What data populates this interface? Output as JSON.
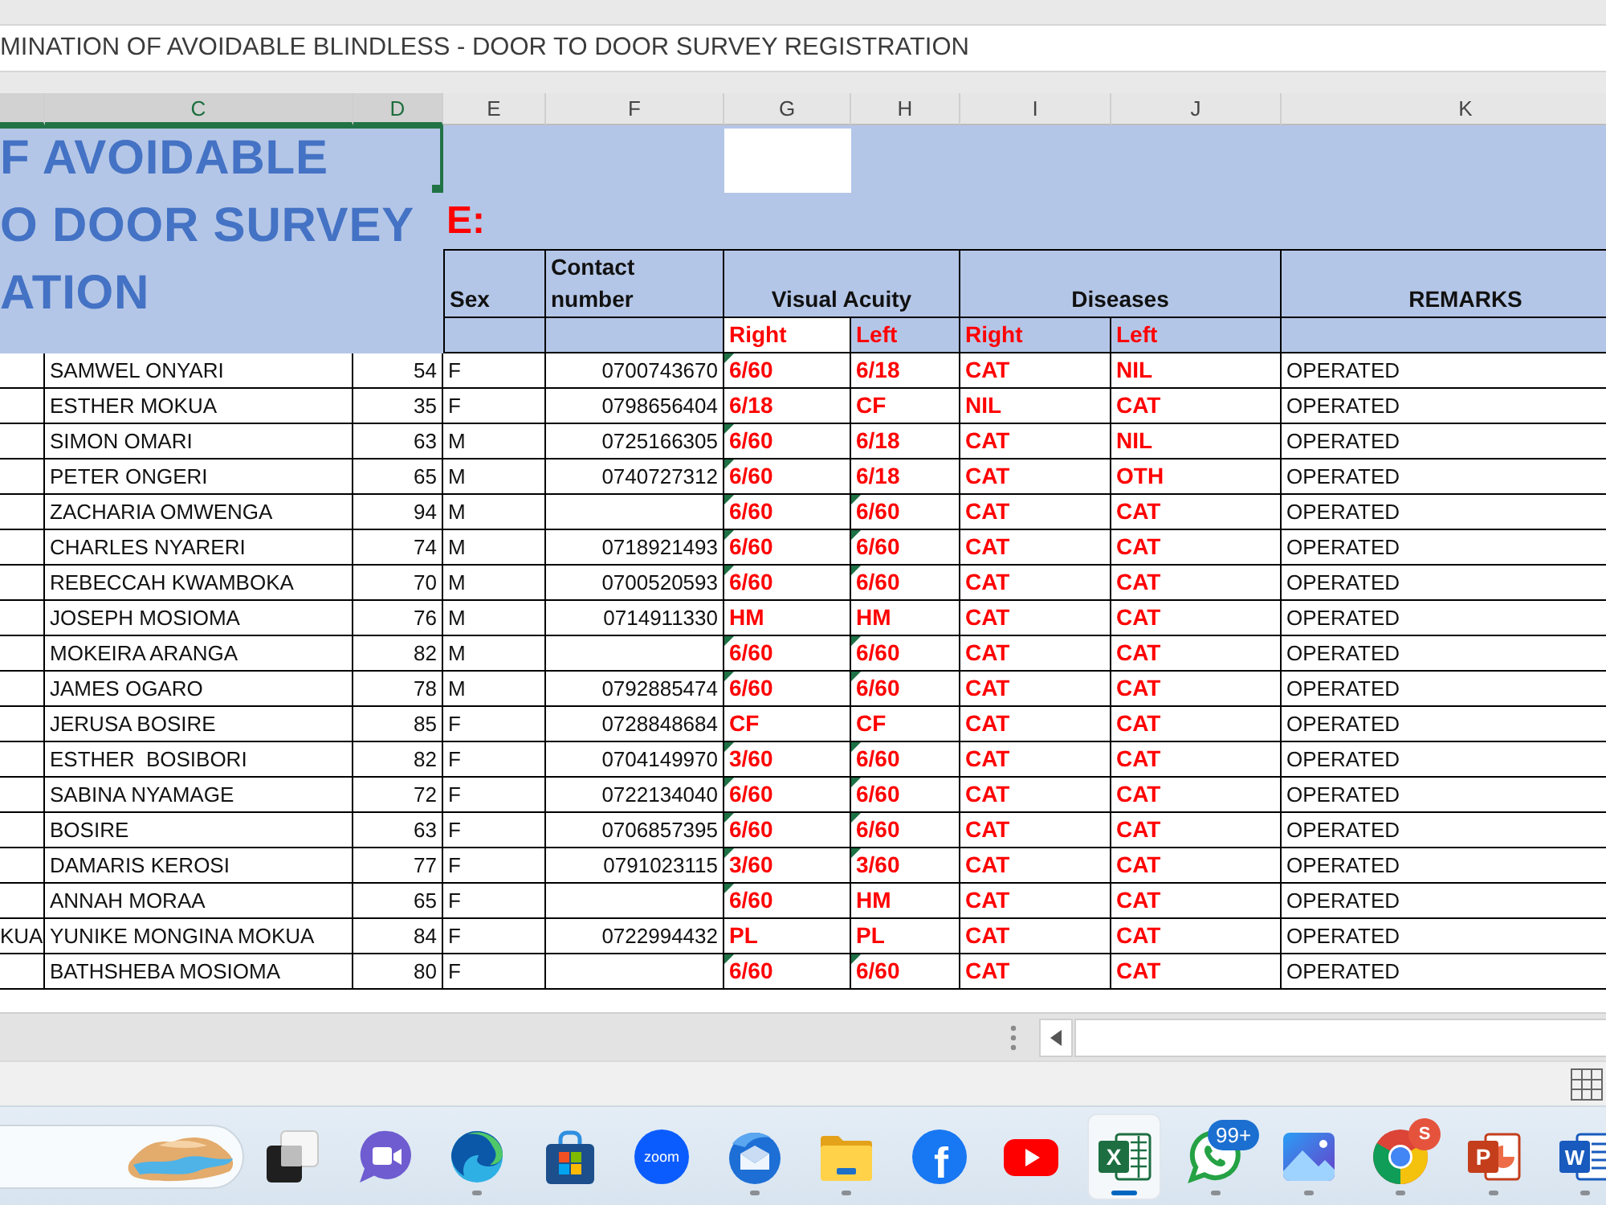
{
  "formula_bar": {
    "value": "MINATION OF AVOIDABLE BLINDLESS - DOOR TO DOOR SURVEY REGISTRATION"
  },
  "column_headers": [
    {
      "selected": true
    },
    {
      "label": "C",
      "selected": true
    },
    {
      "label": "D",
      "selected": true
    },
    {
      "label": "E",
      "selected": false
    },
    {
      "label": "F",
      "selected": false
    },
    {
      "label": "G",
      "selected": false
    },
    {
      "label": "H",
      "selected": false
    },
    {
      "label": "I",
      "selected": false
    },
    {
      "label": "J",
      "selected": false
    },
    {
      "label": "K",
      "selected": false
    }
  ],
  "title": {
    "lines": [
      "F AVOIDABLE",
      "O DOOR SURVEY",
      "ATION"
    ],
    "selected": true,
    "side_label": "E:"
  },
  "table": {
    "headers": [
      "Sex",
      "Contact number",
      "Visual Acuity",
      "Diseases",
      "REMARKS"
    ],
    "subheaders": [
      "Right",
      "Left",
      "Right",
      "Left"
    ],
    "rows": [
      {
        "name": "SAMWEL ONYARI",
        "age": "54",
        "sex": "F",
        "contact": "0700743670",
        "acuity_right": {
          "value": "6/60",
          "flagged": true
        },
        "acuity_left": {
          "value": "6/18",
          "flagged": false
        },
        "disease_right": "CAT",
        "disease_left": "NIL",
        "remarks": "OPERATED"
      },
      {
        "name": "ESTHER MOKUA",
        "age": "35",
        "sex": "F",
        "contact": "0798656404",
        "acuity_right": {
          "value": "6/18",
          "flagged": false
        },
        "acuity_left": {
          "value": "CF",
          "flagged": false
        },
        "disease_right": "NIL",
        "disease_left": "CAT",
        "remarks": "OPERATED"
      },
      {
        "name": "SIMON OMARI",
        "age": "63",
        "sex": "M",
        "contact": "0725166305",
        "acuity_right": {
          "value": "6/60",
          "flagged": true
        },
        "acuity_left": {
          "value": "6/18",
          "flagged": false
        },
        "disease_right": "CAT",
        "disease_left": "NIL",
        "remarks": "OPERATED"
      },
      {
        "name": "PETER ONGERI",
        "age": "65",
        "sex": "M",
        "contact": "0740727312",
        "acuity_right": {
          "value": "6/60",
          "flagged": true
        },
        "acuity_left": {
          "value": "6/18",
          "flagged": false
        },
        "disease_right": "CAT",
        "disease_left": "OTH",
        "remarks": "OPERATED"
      },
      {
        "name": "ZACHARIA OMWENGA",
        "age": "94",
        "sex": "M",
        "acuity_right": {
          "value": "6/60",
          "flagged": true
        },
        "acuity_left": {
          "value": "6/60",
          "flagged": true
        },
        "disease_right": "CAT",
        "disease_left": "CAT",
        "remarks": "OPERATED"
      },
      {
        "name": "CHARLES NYARERI",
        "age": "74",
        "sex": "M",
        "contact": "0718921493",
        "acuity_right": {
          "value": "6/60",
          "flagged": true
        },
        "acuity_left": {
          "value": "6/60",
          "flagged": true
        },
        "disease_right": "CAT",
        "disease_left": "CAT",
        "remarks": "OPERATED"
      },
      {
        "name": "REBECCAH KWAMBOKA",
        "age": "70",
        "sex": "M",
        "contact": "0700520593",
        "acuity_right": {
          "value": "6/60",
          "flagged": true
        },
        "acuity_left": {
          "value": "6/60",
          "flagged": true
        },
        "disease_right": "CAT",
        "disease_left": "CAT",
        "remarks": "OPERATED"
      },
      {
        "name": "JOSEPH MOSIOMA",
        "age": "76",
        "sex": "M",
        "contact": "0714911330",
        "acuity_right": {
          "value": "HM",
          "flagged": false
        },
        "acuity_left": {
          "value": "HM",
          "flagged": false
        },
        "disease_right": "CAT",
        "disease_left": "CAT",
        "remarks": "OPERATED"
      },
      {
        "name": "MOKEIRA ARANGA",
        "age": "82",
        "sex": "M",
        "acuity_right": {
          "value": "6/60",
          "flagged": true
        },
        "acuity_left": {
          "value": "6/60",
          "flagged": true
        },
        "disease_right": "CAT",
        "disease_left": "CAT",
        "remarks": "OPERATED"
      },
      {
        "name": "JAMES OGARO",
        "age": "78",
        "sex": "M",
        "contact": "0792885474",
        "acuity_right": {
          "value": "6/60",
          "flagged": true
        },
        "acuity_left": {
          "value": "6/60",
          "flagged": true
        },
        "disease_right": "CAT",
        "disease_left": "CAT",
        "remarks": "OPERATED"
      },
      {
        "name": "JERUSA BOSIRE",
        "age": "85",
        "sex": "F",
        "contact": "0728848684",
        "acuity_right": {
          "value": "CF",
          "flagged": false
        },
        "acuity_left": {
          "value": "CF",
          "flagged": false
        },
        "disease_right": "CAT",
        "disease_left": "CAT",
        "remarks": "OPERATED"
      },
      {
        "name": "ESTHER  BOSIBORI",
        "age": "82",
        "sex": "F",
        "contact": "0704149970",
        "acuity_right": {
          "value": "3/60",
          "flagged": true
        },
        "acuity_left": {
          "value": "6/60",
          "flagged": true
        },
        "disease_right": "CAT",
        "disease_left": "CAT",
        "remarks": "OPERATED"
      },
      {
        "name": "SABINA NYAMAGE",
        "age": "72",
        "sex": "F",
        "contact": "0722134040",
        "acuity_right": {
          "value": "6/60",
          "flagged": true
        },
        "acuity_left": {
          "value": "6/60",
          "flagged": true
        },
        "disease_right": "CAT",
        "disease_left": "CAT",
        "remarks": "OPERATED"
      },
      {
        "name": "BOSIRE",
        "age": "63",
        "sex": "F",
        "contact": "0706857395",
        "acuity_right": {
          "value": "6/60",
          "flagged": true
        },
        "acuity_left": {
          "value": "6/60",
          "flagged": true
        },
        "disease_right": "CAT",
        "disease_left": "CAT",
        "remarks": "OPERATED"
      },
      {
        "name": "DAMARIS KEROSI",
        "age": "77",
        "sex": "F",
        "contact": "0791023115",
        "acuity_right": {
          "value": "3/60",
          "flagged": true
        },
        "acuity_left": {
          "value": "3/60",
          "flagged": true
        },
        "disease_right": "CAT",
        "disease_left": "CAT",
        "remarks": "OPERATED"
      },
      {
        "name": "ANNAH MORAA",
        "age": "65",
        "sex": "F",
        "acuity_right": {
          "value": "6/60",
          "flagged": true
        },
        "acuity_left": {
          "value": "HM",
          "flagged": false
        },
        "disease_right": "CAT",
        "disease_left": "CAT",
        "remarks": "OPERATED"
      },
      {
        "column_b": "KUA",
        "name": "YUNIKE MONGINA MOKUA",
        "age": "84",
        "sex": "F",
        "contact": "0722994432",
        "acuity_right": {
          "value": "PL",
          "flagged": false
        },
        "acuity_left": {
          "value": "PL",
          "flagged": false
        },
        "disease_right": "CAT",
        "disease_left": "CAT",
        "remarks": "OPERATED"
      },
      {
        "name": "BATHSHEBA MOSIOMA",
        "age": "80",
        "sex": "F",
        "acuity_right": {
          "value": "6/60",
          "flagged": true
        },
        "acuity_left": {
          "value": "6/60",
          "flagged": true
        },
        "disease_right": "CAT",
        "disease_left": "CAT",
        "remarks": "OPERATED"
      }
    ]
  },
  "taskbar": {
    "apps": [
      {
        "kind": "taskview",
        "running": false,
        "selected": false
      },
      {
        "kind": "meet",
        "running": false,
        "selected": false
      },
      {
        "kind": "edge",
        "running": true,
        "selected": false
      },
      {
        "kind": "store",
        "running": false,
        "selected": false
      },
      {
        "kind": "zoom",
        "glyph": "zoom",
        "running": false,
        "selected": false
      },
      {
        "kind": "thunderbird",
        "running": true,
        "selected": false
      },
      {
        "kind": "explorer",
        "running": true,
        "selected": false
      },
      {
        "kind": "facebook",
        "glyph": "f",
        "running": false,
        "selected": false
      },
      {
        "kind": "youtube",
        "running": false,
        "selected": false
      },
      {
        "kind": "excel",
        "glyph": "X",
        "running": true,
        "selected": true
      },
      {
        "kind": "whatsapp",
        "badge": "99+",
        "running": true,
        "selected": false
      },
      {
        "kind": "photos",
        "running": true,
        "selected": false
      },
      {
        "kind": "chrome",
        "badge": "S",
        "running": true,
        "selected": false
      },
      {
        "kind": "powerpoint",
        "glyph": "P",
        "running": true,
        "selected": false
      },
      {
        "kind": "word",
        "glyph": "W",
        "running": true,
        "selected": false
      }
    ]
  }
}
